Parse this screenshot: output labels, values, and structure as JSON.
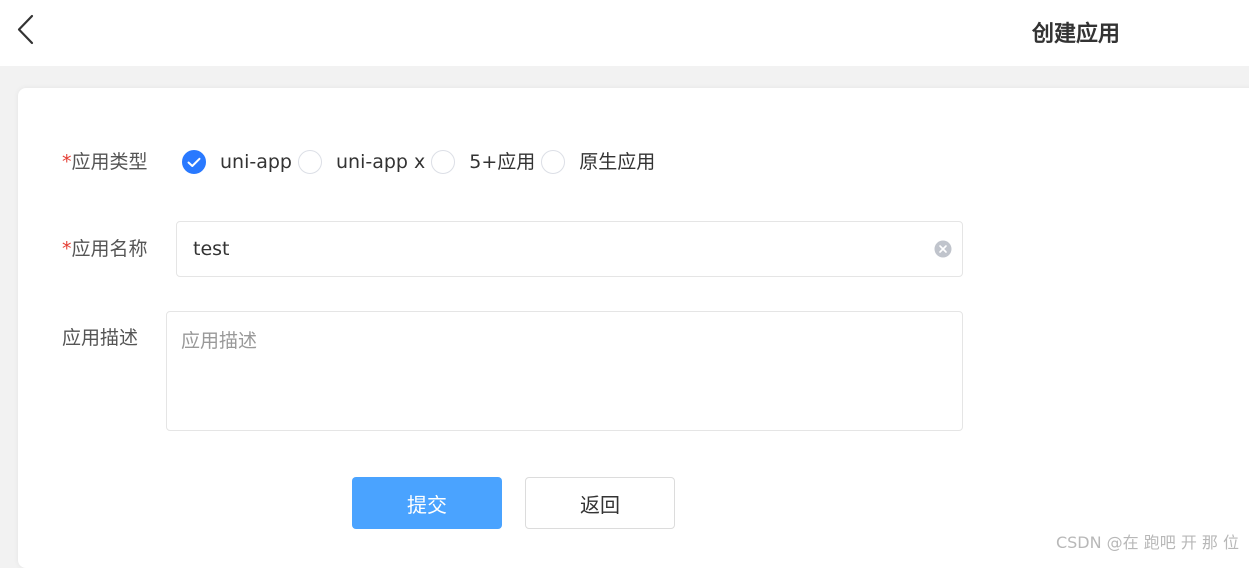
{
  "header": {
    "back_icon": "chevron-left-icon",
    "title": "创建应用"
  },
  "form": {
    "app_type": {
      "required_mark": "*",
      "label": "应用类型",
      "options": [
        {
          "label": "uni-app",
          "checked": true
        },
        {
          "label": "uni-app x",
          "checked": false
        },
        {
          "label": "5+应用",
          "checked": false
        },
        {
          "label": "原生应用",
          "checked": false
        }
      ]
    },
    "app_name": {
      "required_mark": "*",
      "label": "应用名称",
      "value": "test",
      "clear_icon": "clear-circle-icon"
    },
    "app_desc": {
      "label": "应用描述",
      "placeholder": "应用描述",
      "value": ""
    },
    "buttons": {
      "submit": "提交",
      "back": "返回"
    }
  },
  "watermark": "CSDN @在 跑吧 开 那 位",
  "colors": {
    "primary": "#2979ff",
    "submit_button": "#4aa3ff",
    "required": "#e43d33",
    "page_background": "#f2f2f2"
  }
}
